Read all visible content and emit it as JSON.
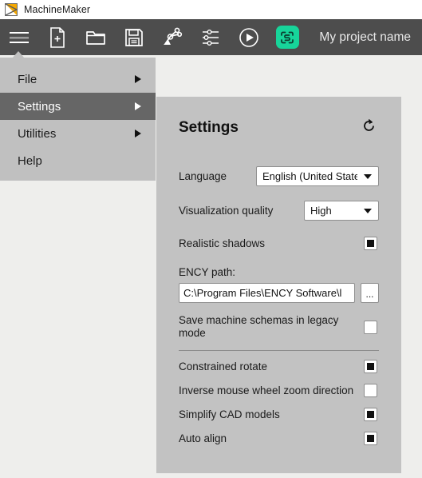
{
  "titlebar": {
    "app_name": "MachineMaker",
    "logo_icon": "triangle-logo-icon",
    "logo_colors": {
      "fill": "#f5a800",
      "stroke": "#5a5a5a"
    }
  },
  "toolbar": {
    "background": "#4d4d4d",
    "buttons": [
      {
        "name": "menu-button",
        "icon": "hamburger-icon",
        "label": "Menu"
      },
      {
        "name": "new-file-button",
        "icon": "new-document-icon",
        "label": "New"
      },
      {
        "name": "open-file-button",
        "icon": "folder-open-icon",
        "label": "Open"
      },
      {
        "name": "save-button",
        "icon": "floppy-disk-icon",
        "label": "Save"
      },
      {
        "name": "robot-button",
        "icon": "robot-arm-icon",
        "label": "Machine"
      },
      {
        "name": "parameters-button",
        "icon": "sliders-icon",
        "label": "Parameters"
      },
      {
        "name": "play-button",
        "icon": "play-circle-icon",
        "label": "Run"
      },
      {
        "name": "ency-button",
        "icon": "ency-logo-icon",
        "label": "ENCY"
      }
    ],
    "project_name": "My project name",
    "ency_badge_color": "#17d59a"
  },
  "menu": {
    "background": "#c0c0c0",
    "active_background": "#666666",
    "items": [
      {
        "label": "File",
        "has_submenu": true,
        "active": false
      },
      {
        "label": "Settings",
        "has_submenu": true,
        "active": true
      },
      {
        "label": "Utilities",
        "has_submenu": true,
        "active": false
      },
      {
        "label": "Help",
        "has_submenu": false,
        "active": false
      }
    ]
  },
  "settings": {
    "title": "Settings",
    "reset_icon": "reset-circular-arrow-icon",
    "background": "#c2c2c2",
    "language": {
      "label": "Language",
      "value": "English (United States)",
      "options": [
        "English (United States)"
      ]
    },
    "visualization_quality": {
      "label": "Visualization quality",
      "value": "High",
      "options": [
        "High"
      ]
    },
    "realistic_shadows": {
      "label": "Realistic shadows",
      "checked": true
    },
    "ency_path": {
      "label": "ENCY path:",
      "value": "C:\\Program Files\\ENCY Software\\l",
      "browse_label": "..."
    },
    "legacy_mode": {
      "label": "Save machine schemas in legacy mode",
      "checked": false
    },
    "options_group": [
      {
        "label": "Constrained rotate",
        "checked": true
      },
      {
        "label": "Inverse mouse wheel zoom direction",
        "checked": false
      },
      {
        "label": "Simplify CAD models",
        "checked": true
      },
      {
        "label": "Auto align",
        "checked": true
      }
    ]
  }
}
